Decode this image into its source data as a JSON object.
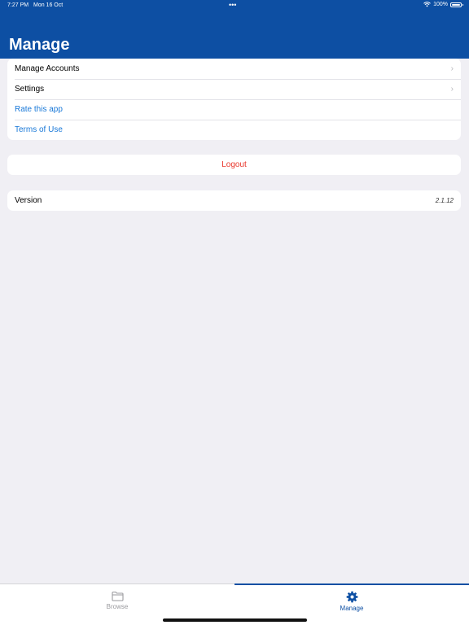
{
  "status_bar": {
    "time": "7:27 PM",
    "date": "Mon 16 Oct",
    "dots": "•••",
    "battery": "100%"
  },
  "header": {
    "title": "Manage"
  },
  "menu_items": [
    {
      "label": "Manage Accounts",
      "chevron": "›"
    },
    {
      "label": "Settings",
      "chevron": "›"
    },
    {
      "label": "Rate this app"
    },
    {
      "label": "Terms of Use"
    }
  ],
  "logout": {
    "label": "Logout"
  },
  "version": {
    "label": "Version",
    "value": "2.1.12"
  },
  "tabbar": {
    "tabs": [
      {
        "label": "Browse",
        "icon": "folder-icon"
      },
      {
        "label": "Manage",
        "icon": "gear-icon",
        "selected": true
      }
    ]
  },
  "colors": {
    "accent": "#0d4fa3",
    "link": "#1878d8",
    "destructive": "#e8352a",
    "background": "#f0eff4"
  }
}
